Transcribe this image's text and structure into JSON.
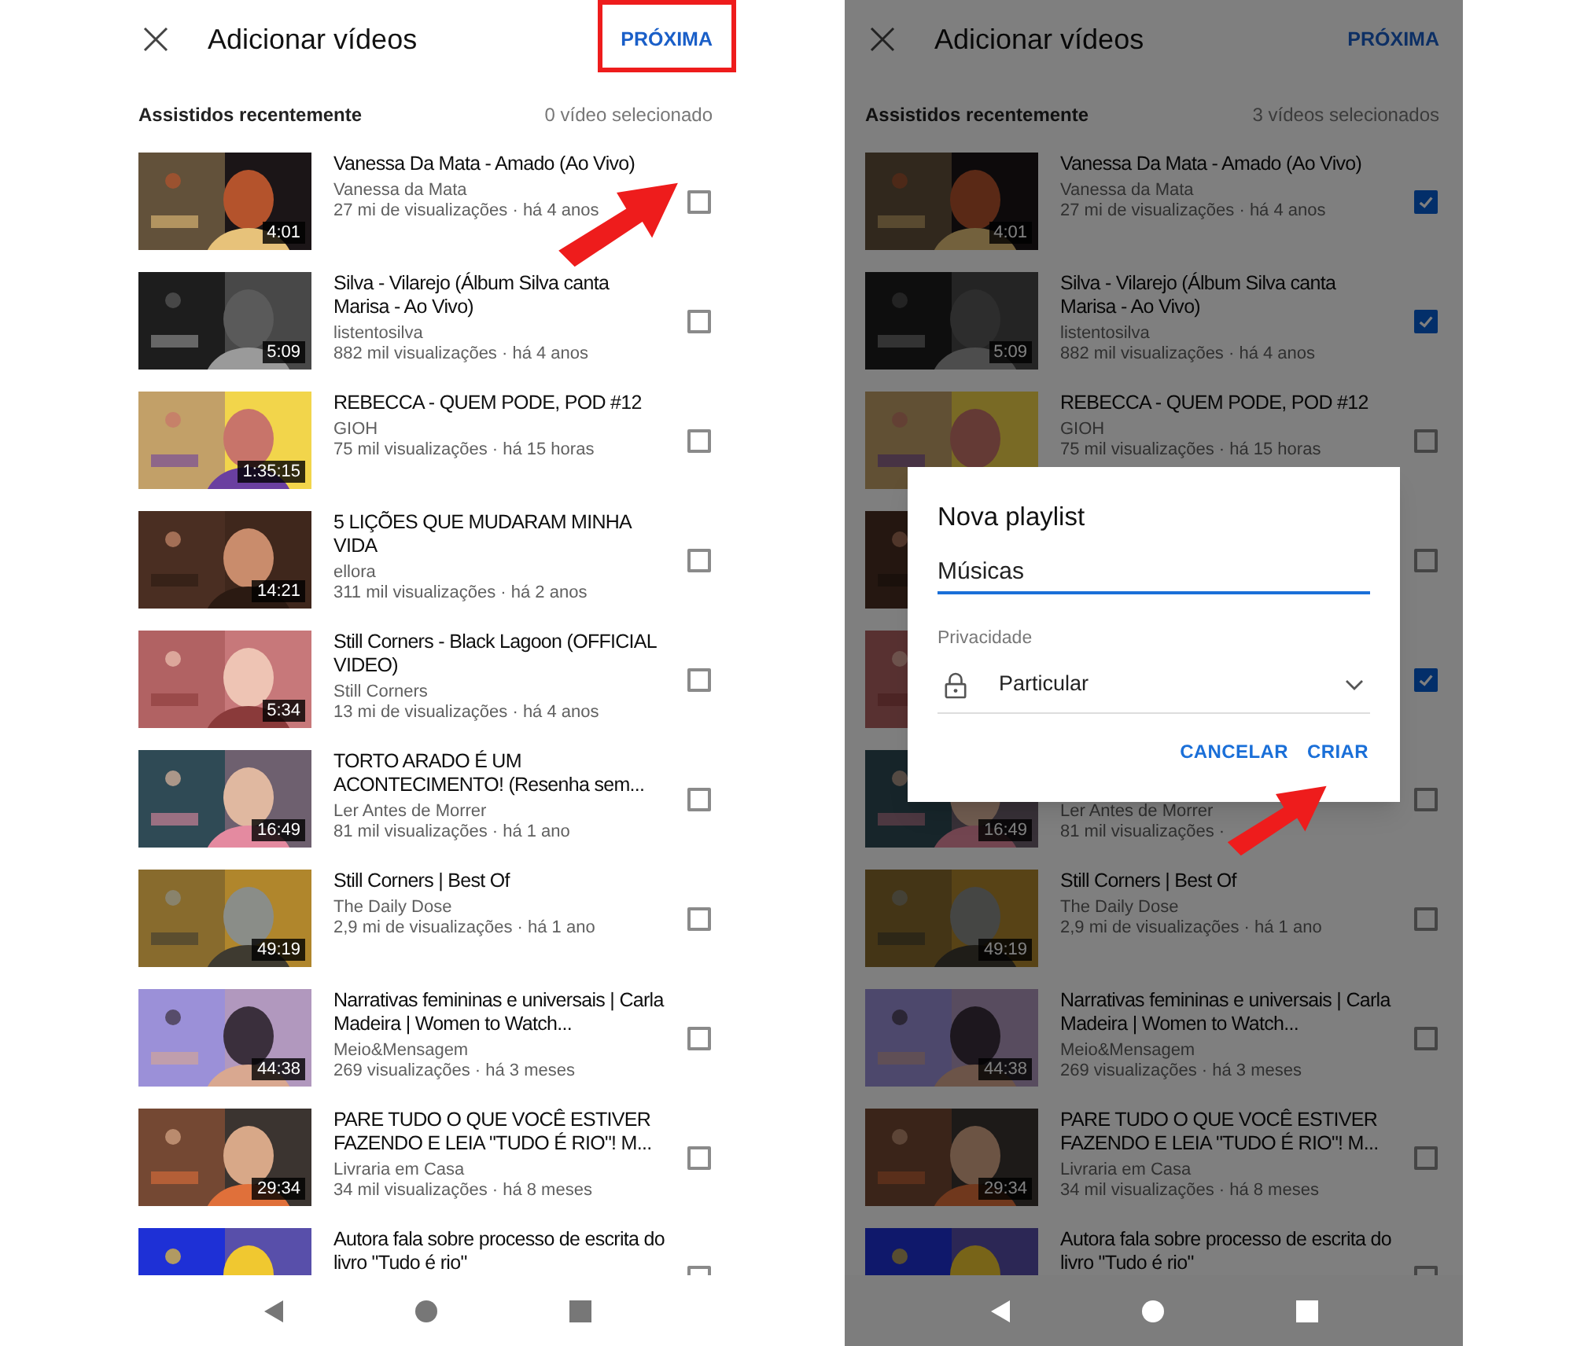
{
  "screens": [
    {
      "header": {
        "title": "Adicionar vídeos",
        "action": "PRÓXIMA"
      },
      "section": {
        "title": "Assistidos recentemente",
        "count": "0 vídeo selecionado"
      },
      "videos": [
        {
          "title": "Vanessa Da Mata - Amado (Ao Vivo)",
          "channel": "Vanessa da Mata",
          "meta": "27 mi de visualizações · há 4 anos",
          "duration": "4:01",
          "checked": false
        },
        {
          "title": "Silva - Vilarejo (Álbum Silva canta Marisa - Ao Vivo)",
          "channel": "listentosilva",
          "meta": "882 mil visualizações · há 4 anos",
          "duration": "5:09",
          "checked": false
        },
        {
          "title": "REBECCA - QUEM PODE, POD #12",
          "channel": "GIOH",
          "meta": "75 mil visualizações · há 15 horas",
          "duration": "1:35:15",
          "checked": false
        },
        {
          "title": "5 LIÇÕES QUE MUDARAM MINHA VIDA",
          "channel": "ellora",
          "meta": "311 mil visualizações · há 2 anos",
          "duration": "14:21",
          "checked": false
        },
        {
          "title": "Still Corners - Black Lagoon (OFFICIAL VIDEO)",
          "channel": "Still Corners",
          "meta": "13 mi de visualizações · há 4 anos",
          "duration": "5:34",
          "checked": false
        },
        {
          "title": "TORTO ARADO É UM ACONTECIMENTO! (Resenha sem...",
          "channel": "Ler Antes de Morrer",
          "meta": "81 mil visualizações · há 1 ano",
          "duration": "16:49",
          "checked": false
        },
        {
          "title": "Still Corners | Best Of",
          "channel": "The Daily Dose",
          "meta": "2,9 mi de visualizações · há 1 ano",
          "duration": "49:19",
          "checked": false
        },
        {
          "title": "Narrativas femininas e universais | Carla Madeira | Women to Watch...",
          "channel": "Meio&Mensagem",
          "meta": "269 visualizações · há 3 meses",
          "duration": "44:38",
          "checked": false
        },
        {
          "title": "PARE TUDO O QUE VOCÊ ESTIVER FAZENDO E LEIA \"TUDO É RIO\"! M...",
          "channel": "Livraria em Casa",
          "meta": "34 mil visualizações · há 8 meses",
          "duration": "29:34",
          "checked": false
        },
        {
          "title": "Autora fala sobre processo de escrita do livro \"Tudo é rio\"",
          "checked": false
        }
      ]
    },
    {
      "header": {
        "title": "Adicionar vídeos",
        "action": "PRÓXIMA"
      },
      "section": {
        "title": "Assistidos recentemente",
        "count": "3 vídeos selecionados"
      },
      "videos": [
        {
          "title": "Vanessa Da Mata - Amado (Ao Vivo)",
          "channel": "Vanessa da Mata",
          "meta": "27 mi de visualizações · há 4 anos",
          "duration": "4:01",
          "checked": true
        },
        {
          "title": "Silva - Vilarejo (Álbum Silva canta Marisa - Ao Vivo)",
          "channel": "listentosilva",
          "meta": "882 mil visualizações · há 4 anos",
          "duration": "5:09",
          "checked": true
        },
        {
          "title": "REBECCA - QUEM PODE, POD #12",
          "channel": "GIOH",
          "meta": "75 mil visualizações · há 15 horas",
          "checked": false
        },
        {
          "checked": false
        },
        {
          "checked": true
        },
        {
          "channel": "Ler Antes de Morrer",
          "meta": "81 mil visualizações ·",
          "duration": "16:49",
          "checked": false
        },
        {
          "title": "Still Corners | Best Of",
          "channel": "The Daily Dose",
          "meta": "2,9 mi de visualizações · há 1 ano",
          "duration": "49:19",
          "checked": false
        },
        {
          "title": "Narrativas femininas e universais | Carla Madeira | Women to Watch...",
          "channel": "Meio&Mensagem",
          "meta": "269 visualizações · há 3 meses",
          "duration": "44:38",
          "checked": false
        },
        {
          "title": "PARE TUDO O QUE VOCÊ ESTIVER FAZENDO E LEIA \"TUDO É RIO\"! M...",
          "channel": "Livraria em Casa",
          "meta": "34 mil visualizações · há 8 meses",
          "duration": "29:34",
          "checked": false
        },
        {
          "title": "Autora fala sobre processo de escrita do livro \"Tudo é rio\"",
          "checked": false
        }
      ],
      "dialog": {
        "title": "Nova playlist",
        "name_value": "Músicas",
        "privacy_label": "Privacidade",
        "privacy_value": "Particular",
        "buttons": [
          "CANCELAR",
          "CRIAR"
        ]
      }
    }
  ]
}
